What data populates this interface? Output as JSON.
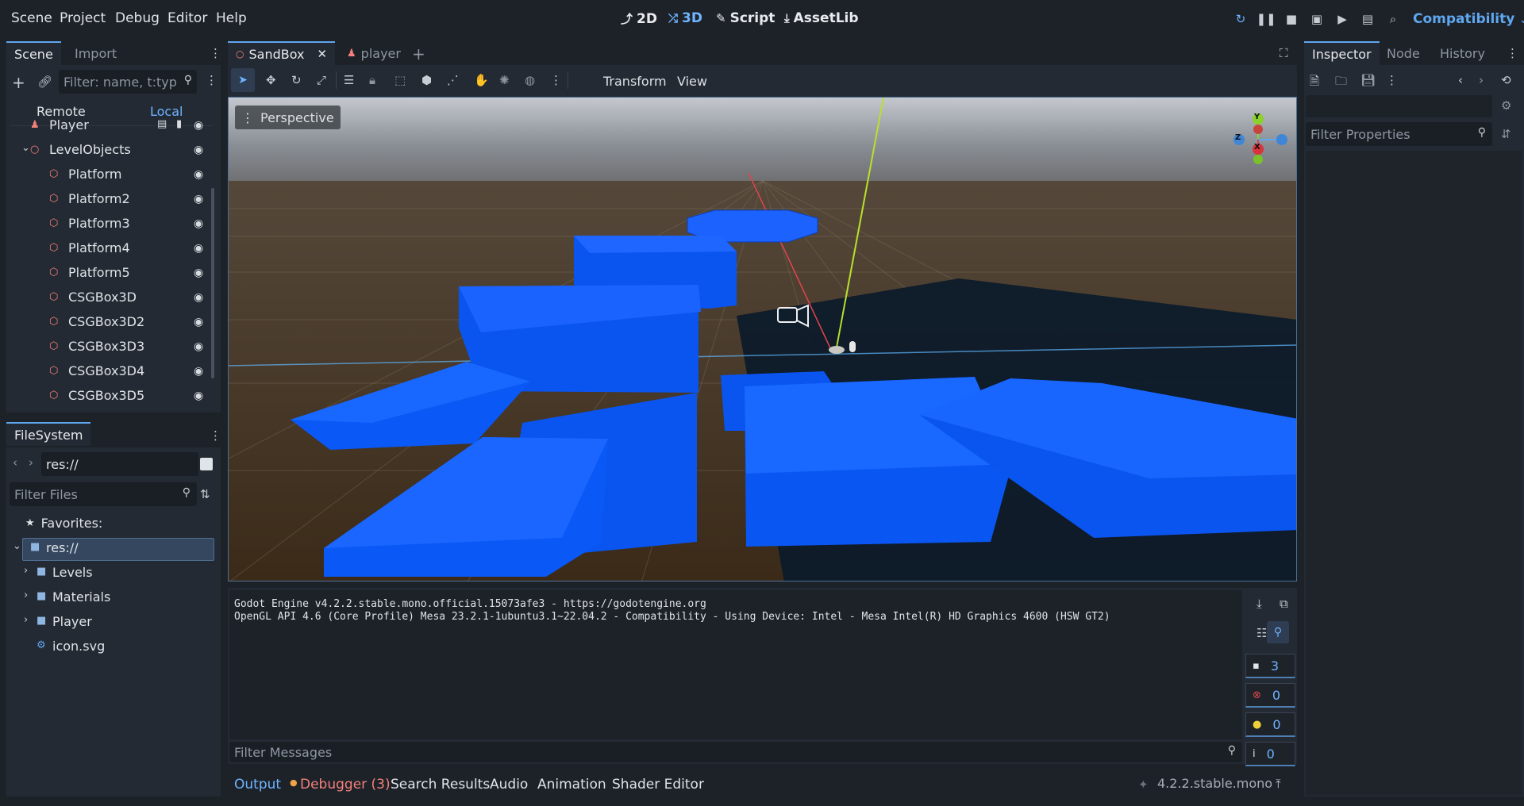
{
  "menu": [
    "Scene",
    "Project",
    "Debug",
    "Editor",
    "Help"
  ],
  "workspaces": [
    {
      "label": "2D",
      "icon": "2d-icon"
    },
    {
      "label": "3D",
      "icon": "3d-icon",
      "active": true
    },
    {
      "label": "Script",
      "icon": "script-icon"
    },
    {
      "label": "AssetLib",
      "icon": "assetlib-icon"
    }
  ],
  "renderer": "Compatibility",
  "scene_dock": {
    "tabs": [
      "Scene",
      "Import"
    ],
    "filter_placeholder": "Filter: name, t:typ",
    "remote_label": "Remote",
    "local_label": "Local",
    "tree": [
      {
        "label": "Player",
        "indent": 1,
        "icon": "player-icon"
      },
      {
        "label": "LevelObjects",
        "indent": 1,
        "icon": "node3d-icon",
        "expanded": true
      },
      {
        "label": "Platform",
        "indent": 2,
        "icon": "csg-icon"
      },
      {
        "label": "Platform2",
        "indent": 2,
        "icon": "csg-icon"
      },
      {
        "label": "Platform3",
        "indent": 2,
        "icon": "csg-icon"
      },
      {
        "label": "Platform4",
        "indent": 2,
        "icon": "csg-icon"
      },
      {
        "label": "Platform5",
        "indent": 2,
        "icon": "csg-icon"
      },
      {
        "label": "CSGBox3D",
        "indent": 2,
        "icon": "csg-icon"
      },
      {
        "label": "CSGBox3D2",
        "indent": 2,
        "icon": "csg-icon"
      },
      {
        "label": "CSGBox3D3",
        "indent": 2,
        "icon": "csg-icon"
      },
      {
        "label": "CSGBox3D4",
        "indent": 2,
        "icon": "csg-icon"
      },
      {
        "label": "CSGBox3D5",
        "indent": 2,
        "icon": "csg-icon"
      }
    ]
  },
  "filesystem": {
    "title": "FileSystem",
    "path": "res://",
    "filter_placeholder": "Filter Files",
    "favorites_label": "Favorites:",
    "items": [
      {
        "label": "res://",
        "indent": 0,
        "type": "folder",
        "selected": true
      },
      {
        "label": "Levels",
        "indent": 1,
        "type": "folder"
      },
      {
        "label": "Materials",
        "indent": 1,
        "type": "folder"
      },
      {
        "label": "Player",
        "indent": 1,
        "type": "folder"
      },
      {
        "label": "icon.svg",
        "indent": 1,
        "type": "file"
      }
    ]
  },
  "editor_tabs": [
    {
      "label": "SandBox",
      "active": true
    },
    {
      "label": "player",
      "active": false
    }
  ],
  "viewport_toolbar": {
    "transform_label": "Transform",
    "view_label": "View",
    "perspective_label": "Perspective"
  },
  "gizmo": {
    "y": "Y",
    "z": "Z",
    "x": "X"
  },
  "output": {
    "lines": [
      "Godot Engine v4.2.2.stable.mono.official.15073afe3 - https://godotengine.org",
      "OpenGL API 4.6 (Core Profile) Mesa 23.2.1-1ubuntu3.1~22.04.2 - Compatibility - Using Device: Intel - Mesa Intel(R) HD Graphics 4600 (HSW GT2)"
    ],
    "filter_placeholder": "Filter Messages",
    "counts": {
      "messages": "3",
      "errors": "0",
      "warnings": "0",
      "info": "0"
    }
  },
  "bottom_tabs": [
    "Output",
    "Debugger (3)",
    "Search Results",
    "Audio",
    "Animation",
    "Shader Editor"
  ],
  "version": "4.2.2.stable.mono",
  "inspector": {
    "tabs": [
      "Inspector",
      "Node",
      "History"
    ],
    "filter_placeholder": "Filter Properties"
  },
  "colors": {
    "accent": "#5fa7ef",
    "platform_blue": "#0a5cff",
    "node_red": "#f3807a",
    "error": "#e0494c",
    "warning": "#f0d03a"
  }
}
